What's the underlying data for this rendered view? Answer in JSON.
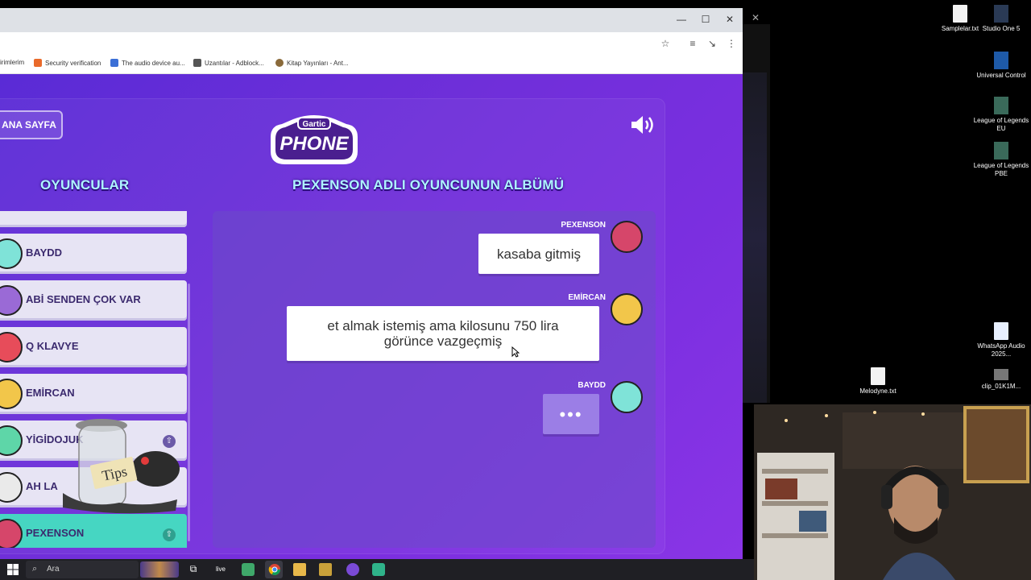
{
  "browser": {
    "bookmarks": [
      "irimlerim",
      "Security verification",
      "The audio device au...",
      "Uzantılar - Adblock...",
      "Kitap Yayınları - Ant..."
    ],
    "bookmark_colors": [
      "#888888",
      "#e96a2b",
      "#3b6fd6",
      "#555555",
      "#8a6a3a"
    ]
  },
  "game": {
    "home_label": "ANA SAYFA",
    "logo_top": "Gartic",
    "logo_bottom": "PHONE",
    "players_heading": "OYUNCULAR",
    "album_heading": "PEXENSON ADLI OYUNCUNUN ALBÜMÜ",
    "players": [
      {
        "name": "BAYDD",
        "color": "#7fe3d8",
        "host": false,
        "active": false
      },
      {
        "name": "ABİ SENDEN ÇOK VAR",
        "color": "#9a6ad6",
        "host": false,
        "active": false
      },
      {
        "name": "Q KLAVYE",
        "color": "#e74c5a",
        "host": false,
        "active": false
      },
      {
        "name": "EMİRCAN",
        "color": "#f2c64a",
        "host": false,
        "active": false
      },
      {
        "name": "YİGİDOJUK",
        "color": "#5ed6a8",
        "host": true,
        "active": false
      },
      {
        "name": "AH LA",
        "color": "#eaeaea",
        "host": false,
        "active": false
      },
      {
        "name": "PEXENSON",
        "color": "#d6466a",
        "host": true,
        "active": true
      }
    ],
    "messages": [
      {
        "author": "PEXENSON",
        "text": "kasaba gitmiş",
        "avatar_color": "#d6466a"
      },
      {
        "author": "EMİRCAN",
        "text": "et almak istemiş ama kilosunu 750 lira görünce vazgeçmiş",
        "avatar_color": "#f2c64a"
      },
      {
        "author": "BAYDD",
        "text": "•••",
        "avatar_color": "#7fe3d8"
      }
    ],
    "tips_label": "Tips"
  },
  "desktop": {
    "icons": [
      {
        "label": "Samplelar.txt"
      },
      {
        "label": "Studio One 5"
      },
      {
        "label": "Universal Control"
      },
      {
        "label": "League of Legends EU"
      },
      {
        "label": "League of Legends PBE"
      },
      {
        "label": "WhatsApp Audio 2025..."
      },
      {
        "label": "Melodyne.txt"
      },
      {
        "label": "clip_01K1M..."
      }
    ]
  },
  "taskbar": {
    "search_placeholder": "Ara",
    "live_label": "live"
  }
}
